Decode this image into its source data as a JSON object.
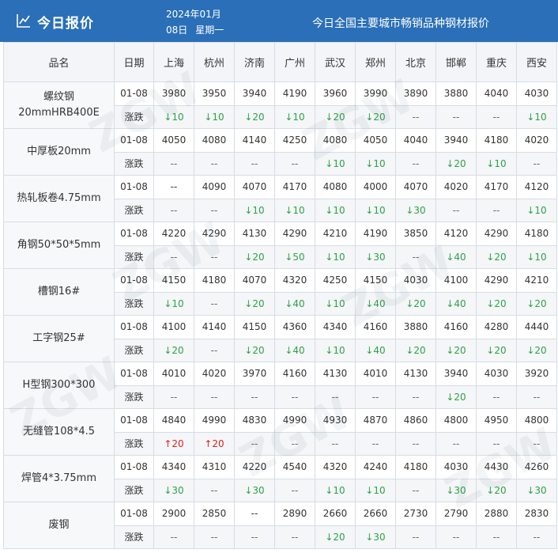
{
  "header": {
    "title": "今日报价",
    "date_line1": "2024年01月",
    "day": "08日",
    "weekday": "星期一",
    "subtitle": "今日全国主要城市畅销品种钢材报价"
  },
  "table": {
    "columns": [
      "品名",
      "日期",
      "上海",
      "杭州",
      "济南",
      "广州",
      "武汉",
      "郑州",
      "北京",
      "邯郸",
      "重庆",
      "西安"
    ],
    "change_label": "涨跌",
    "rows": [
      {
        "name": [
          "螺纹钢",
          "20mmHRB400E"
        ],
        "date": "01-08",
        "prices": [
          "3980",
          "3950",
          "3940",
          "4190",
          "3960",
          "3990",
          "3890",
          "3880",
          "4040",
          "4030"
        ],
        "changes": [
          "↓10",
          "↓10",
          "↓20",
          "↓10",
          "↓20",
          "↓20",
          "--",
          "--",
          "--",
          "↓10"
        ]
      },
      {
        "name": [
          "中厚板20mm"
        ],
        "date": "01-08",
        "prices": [
          "4050",
          "4080",
          "4140",
          "4250",
          "4080",
          "4050",
          "4040",
          "3940",
          "4180",
          "4020"
        ],
        "changes": [
          "--",
          "--",
          "--",
          "--",
          "↓10",
          "↓10",
          "--",
          "↓20",
          "↓10",
          "--"
        ]
      },
      {
        "name": [
          "热轧板卷4.75mm"
        ],
        "date": "01-08",
        "prices": [
          "--",
          "4090",
          "4070",
          "4170",
          "4080",
          "4000",
          "4070",
          "4020",
          "4170",
          "4120"
        ],
        "changes": [
          "--",
          "--",
          "↓10",
          "↓10",
          "↓10",
          "↓10",
          "↓30",
          "--",
          "--",
          "↓10"
        ]
      },
      {
        "name": [
          "角钢50*50*5mm"
        ],
        "date": "01-08",
        "prices": [
          "4220",
          "4290",
          "4130",
          "4290",
          "4210",
          "4190",
          "3850",
          "4120",
          "4290",
          "4180"
        ],
        "changes": [
          "--",
          "--",
          "↓20",
          "↓50",
          "↓10",
          "↓30",
          "--",
          "↓40",
          "↓20",
          "↓10"
        ]
      },
      {
        "name": [
          "槽钢16#"
        ],
        "date": "01-08",
        "prices": [
          "4150",
          "4180",
          "4070",
          "4320",
          "4250",
          "4150",
          "4030",
          "4100",
          "4290",
          "4210"
        ],
        "changes": [
          "↓10",
          "--",
          "↓20",
          "↓40",
          "↓10",
          "↓40",
          "↓20",
          "↓40",
          "↓20",
          "↓20"
        ]
      },
      {
        "name": [
          "工字钢25#"
        ],
        "date": "01-08",
        "prices": [
          "4100",
          "4140",
          "4150",
          "4360",
          "4340",
          "4160",
          "3880",
          "4160",
          "4280",
          "4440"
        ],
        "changes": [
          "↓20",
          "--",
          "↓20",
          "↓40",
          "↓10",
          "↓40",
          "↓20",
          "↓20",
          "↓20",
          "↓20"
        ]
      },
      {
        "name": [
          "H型钢300*300"
        ],
        "date": "01-08",
        "prices": [
          "4010",
          "4020",
          "3970",
          "4160",
          "4130",
          "4010",
          "4130",
          "3940",
          "4030",
          "3920"
        ],
        "changes": [
          "--",
          "--",
          "--",
          "--",
          "--",
          "--",
          "--",
          "↓20",
          "--",
          "--"
        ]
      },
      {
        "name": [
          "无缝管108*4.5"
        ],
        "date": "01-08",
        "prices": [
          "4840",
          "4990",
          "4830",
          "4990",
          "4930",
          "4870",
          "4860",
          "4800",
          "4950",
          "4800"
        ],
        "changes": [
          "↑20",
          "↑20",
          "--",
          "--",
          "--",
          "--",
          "--",
          "--",
          "--",
          "--"
        ]
      },
      {
        "name": [
          "焊管4*3.75mm"
        ],
        "date": "01-08",
        "prices": [
          "4340",
          "4310",
          "4220",
          "4540",
          "4320",
          "4240",
          "4180",
          "4030",
          "4430",
          "4260"
        ],
        "changes": [
          "↓30",
          "--",
          "↓30",
          "--",
          "↓10",
          "↓10",
          "--",
          "↓30",
          "↓20",
          "↓30"
        ]
      },
      {
        "name": [
          "废钢"
        ],
        "date": "01-08",
        "prices": [
          "2900",
          "2850",
          "--",
          "2890",
          "2660",
          "2660",
          "2730",
          "2790",
          "2880",
          "2830"
        ],
        "changes": [
          "--",
          "--",
          "--",
          "--",
          "↓20",
          "↓30",
          "--",
          "--",
          "--",
          "--"
        ]
      }
    ]
  }
}
